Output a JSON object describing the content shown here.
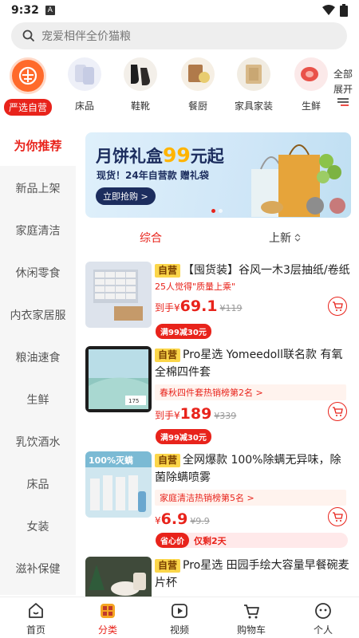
{
  "status": {
    "time": "9:32",
    "notif": "A"
  },
  "search": {
    "placeholder": "宠爱相伴全价猫粮"
  },
  "categories": [
    {
      "label": "严选自营",
      "icon": "store-icon",
      "selected": true
    },
    {
      "label": "床品",
      "icon": "bedding-icon"
    },
    {
      "label": "鞋靴",
      "icon": "shoes-icon"
    },
    {
      "label": "餐厨",
      "icon": "kitchen-icon"
    },
    {
      "label": "家具家装",
      "icon": "furniture-icon"
    },
    {
      "label": "生鲜",
      "icon": "fresh-icon"
    }
  ],
  "expand": {
    "line1": "全部",
    "line2": "展开"
  },
  "left_nav": [
    {
      "label": "为你推荐",
      "active": true
    },
    {
      "label": "新品上架"
    },
    {
      "label": "家庭清洁"
    },
    {
      "label": "休闲零食"
    },
    {
      "label": "内衣家居服"
    },
    {
      "label": "粮油速食"
    },
    {
      "label": "生鲜"
    },
    {
      "label": "乳饮酒水"
    },
    {
      "label": "床品"
    },
    {
      "label": "女装"
    },
    {
      "label": "滋补保健"
    }
  ],
  "banner": {
    "title_pre": "月饼礼盒",
    "title_hl": "99",
    "title_post": "元起",
    "subtitle": "现货！24年自营款 赠礼袋",
    "cta": "立即抢购 >"
  },
  "sort": {
    "comprehensive": "综合",
    "newest": "上新"
  },
  "products": [
    {
      "tag": "自营",
      "title": "【囤货装】谷风一木3层抽纸/卷纸",
      "social": "25人觉得\"质量上乘\"",
      "price_prefix": "到手¥",
      "price": "69.1",
      "orig_price": "¥119",
      "promo": "满99减30元"
    },
    {
      "tag": "自营",
      "title": "Pro星选 Yomeedoll联名款 有氧全棉四件套",
      "rank": "春秋四件套热销榜第2名 >",
      "price_prefix": "到手¥",
      "price": "189",
      "orig_price": "¥339",
      "promo": "满99减30元"
    },
    {
      "tag": "自营",
      "title": "全网爆款 100%除螨无异味，除菌除螨喷雾",
      "rank": "家庭清洁热销榜第5名 >",
      "price_prefix": "¥",
      "price": "6.9",
      "orig_price": "¥9.9",
      "promo": "省心价",
      "promo_note": "仅剩2天"
    },
    {
      "tag": "自营",
      "title": "Pro星选 田园手绘大容量早餐碗麦片杯"
    }
  ],
  "product_img_text": {
    "p2_badge": "175",
    "p3_badge": "100%灭螨"
  },
  "bottom_nav": [
    {
      "label": "首页",
      "icon": "home-icon"
    },
    {
      "label": "分类",
      "icon": "category-icon",
      "active": true
    },
    {
      "label": "视频",
      "icon": "video-icon"
    },
    {
      "label": "购物车",
      "icon": "cart-icon"
    },
    {
      "label": "个人",
      "icon": "profile-icon"
    }
  ],
  "colors": {
    "accent": "#e8231b",
    "tag": "#fbd64a",
    "banner_navy": "#1c2d5e"
  }
}
